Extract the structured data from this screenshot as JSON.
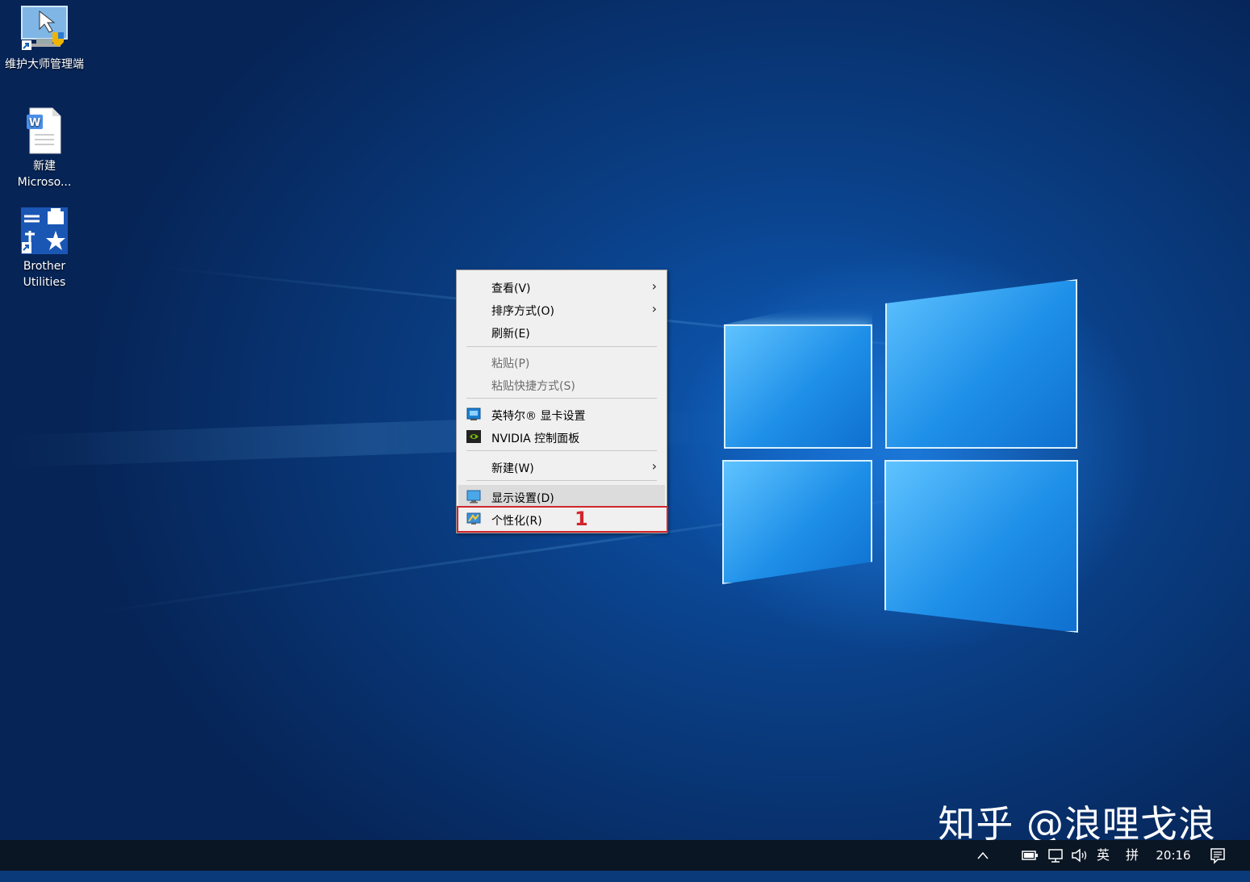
{
  "desktop_icons": [
    {
      "label": "维护大师管理端",
      "icon": "admin-console-icon"
    },
    {
      "label": "新建 Microso...",
      "icon": "word-document-icon"
    },
    {
      "label": "Brother Utilities",
      "icon": "brother-utilities-icon"
    }
  ],
  "context_menu": {
    "items": {
      "view": "查看(V)",
      "sort": "排序方式(O)",
      "refresh": "刷新(E)",
      "paste": "粘贴(P)",
      "paste_shortcut": "粘贴快捷方式(S)",
      "intel": "英特尔® 显卡设置",
      "nvidia": "NVIDIA 控制面板",
      "new": "新建(W)",
      "display": "显示设置(D)",
      "personalize": "个性化(R)"
    },
    "submenu_arrow": "›",
    "annotation_number": "1",
    "annotation_color": "#d0262c"
  },
  "watermark": "知乎 @浪哩戈浪",
  "taskbar": {
    "tray_chevron": "^",
    "input_lang": "英",
    "ime": "拼",
    "time": "20:16",
    "icons": [
      "chevron-up-icon",
      "battery-icon",
      "network-icon",
      "volume-icon",
      "notification-icon"
    ]
  }
}
